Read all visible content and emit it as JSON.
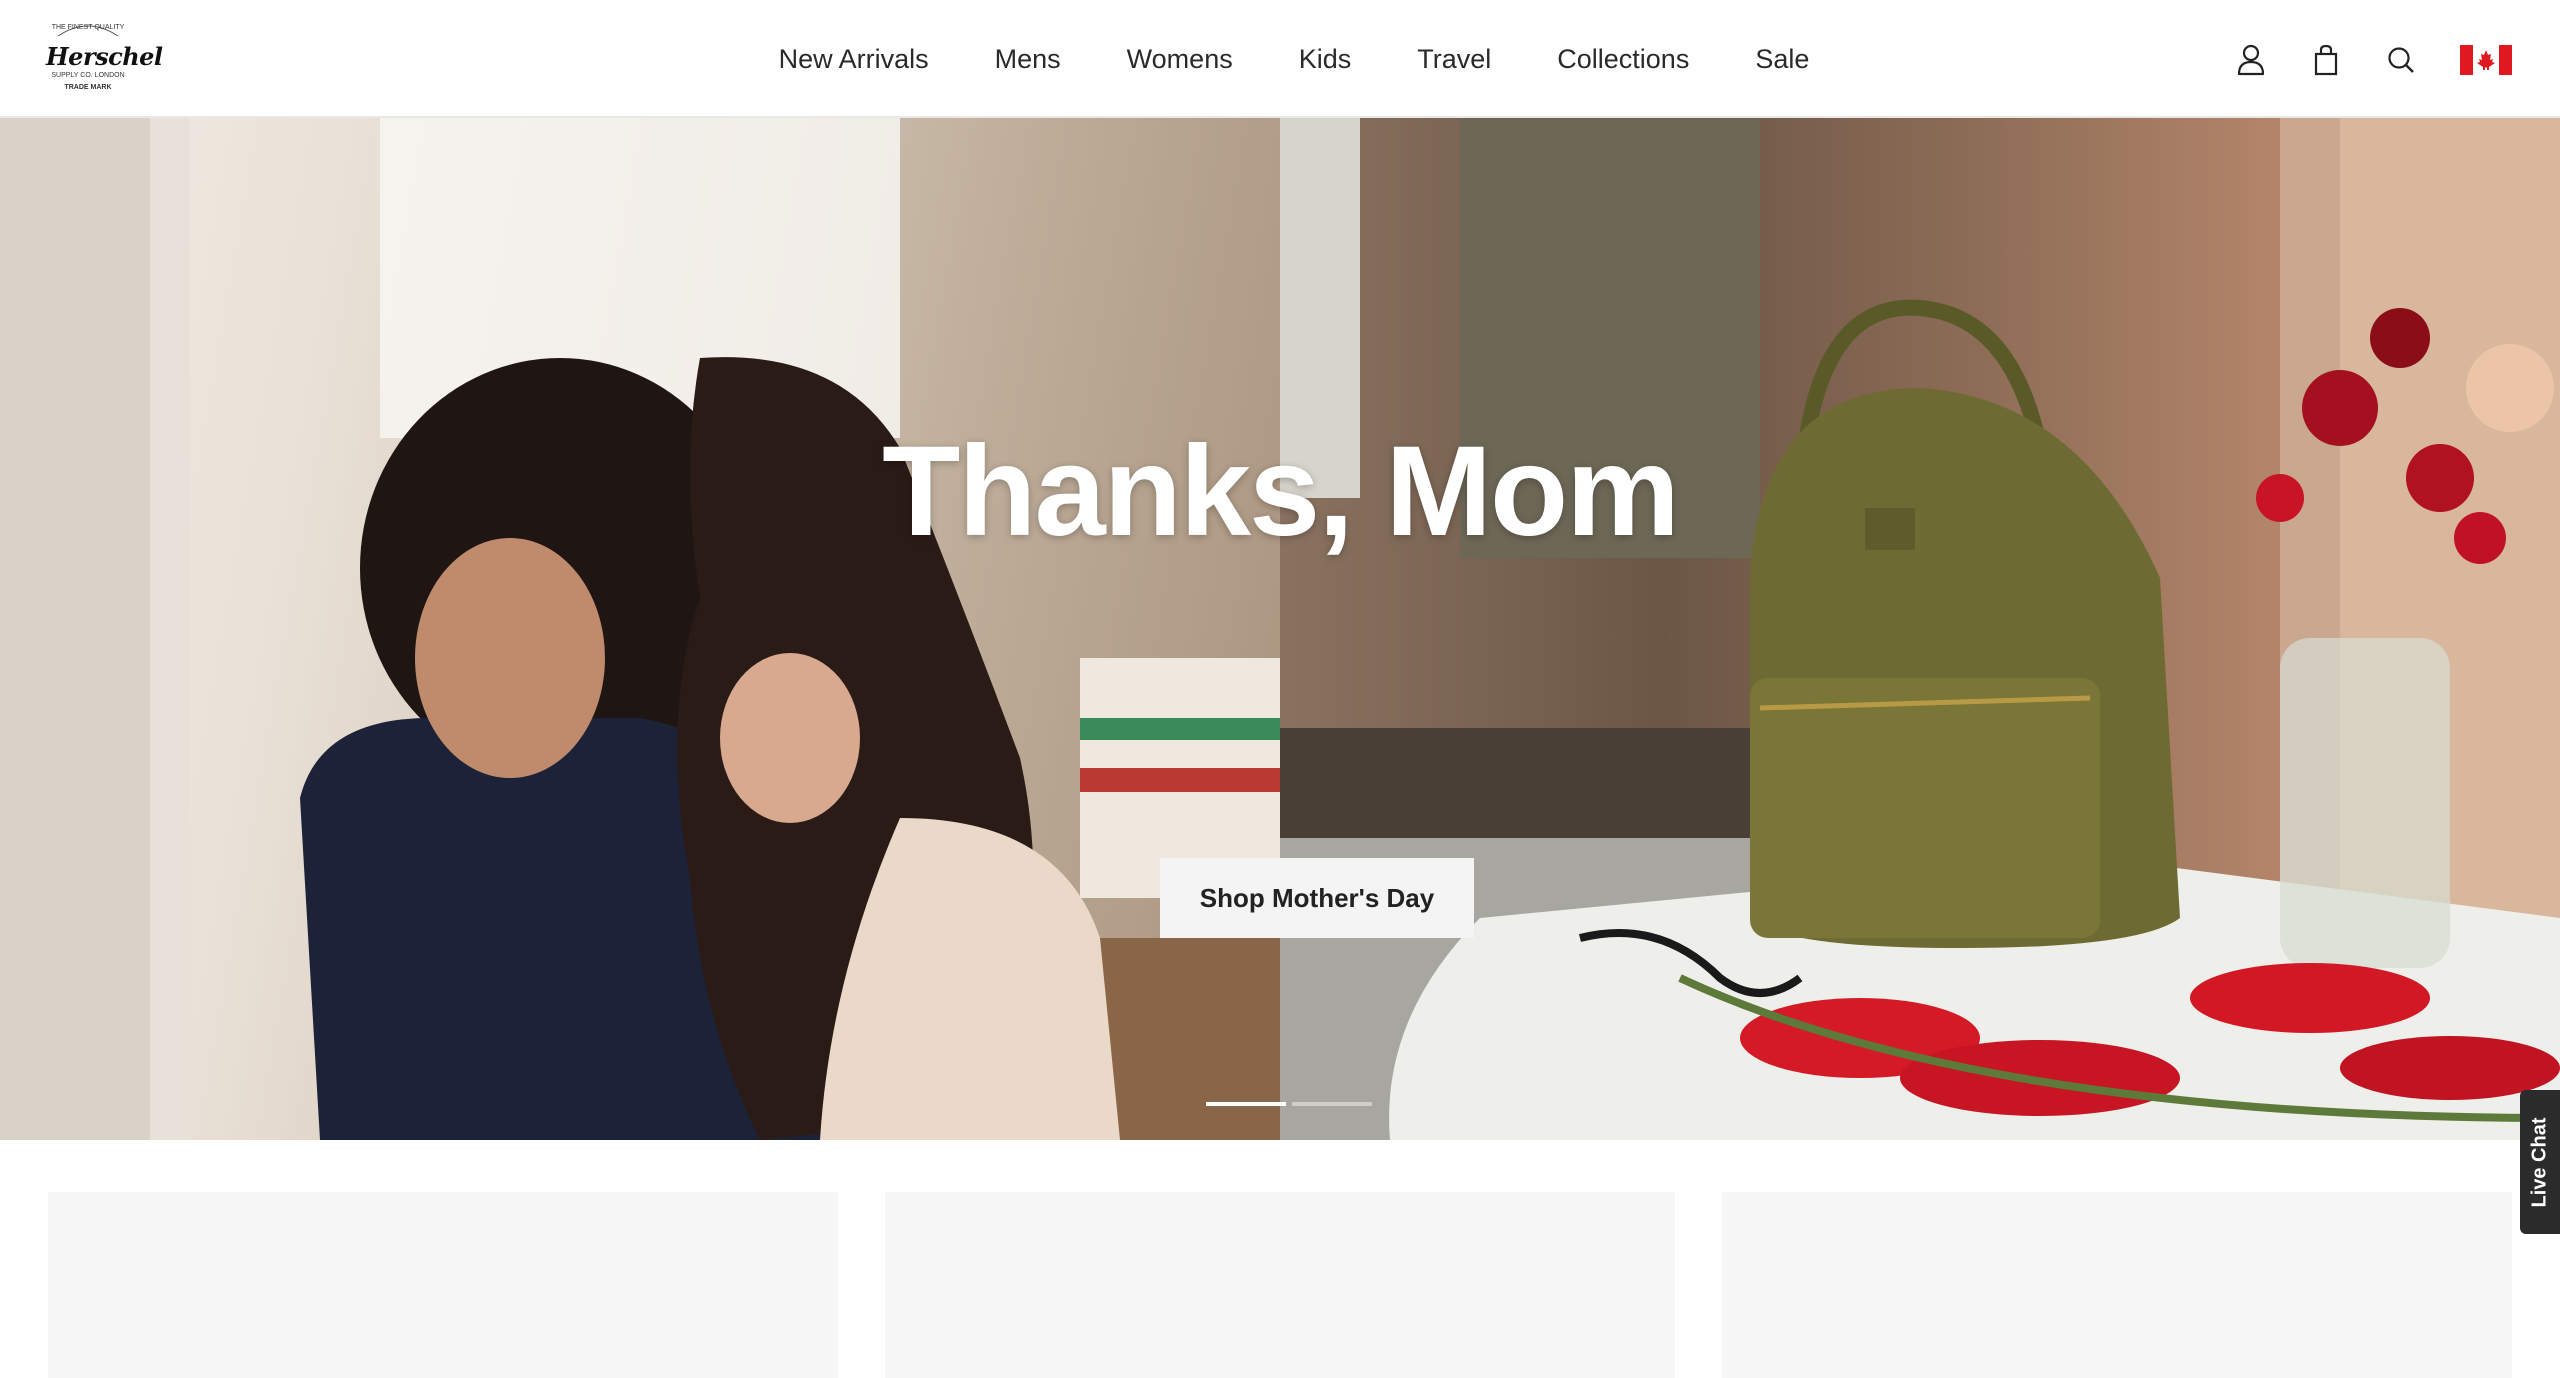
{
  "header": {
    "logo": {
      "name": "Herschel",
      "top_text": "THE FINEST QUALITY",
      "sub_text": "SUPPLY CO. LONDON",
      "trademark": "TRADE MARK"
    },
    "nav": [
      {
        "label": "New Arrivals"
      },
      {
        "label": "Mens"
      },
      {
        "label": "Womens"
      },
      {
        "label": "Kids"
      },
      {
        "label": "Travel"
      },
      {
        "label": "Collections"
      },
      {
        "label": "Sale"
      }
    ],
    "icons": [
      "account-icon",
      "bag-icon",
      "search-icon",
      "canada-flag-icon"
    ]
  },
  "hero": {
    "title": "Thanks, Mom",
    "cta_label": "Shop Mother's Day",
    "slides_total": 2,
    "active_slide": 1
  },
  "live_chat": {
    "label": "Live Chat"
  },
  "colors": {
    "flag_red": "#e0181f",
    "cta_bg": "#f4f4f4",
    "card_bg": "#f7f7f7",
    "live_chat_bg": "#2b2b2b"
  }
}
